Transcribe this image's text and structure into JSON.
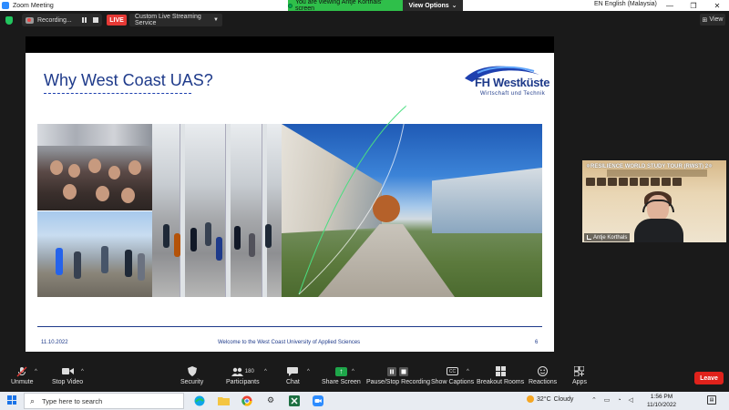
{
  "window": {
    "title": "Zoom Meeting",
    "controls": [
      "—",
      "❐",
      "✕"
    ]
  },
  "share_banner": {
    "message": "You are viewing Antje Korthals' screen",
    "view_options": "View Options"
  },
  "language": "EN English (Malaysia)",
  "recording": {
    "label": "Recording..."
  },
  "live_badge": "LIVE",
  "stream_service": "Custom Live Streaming Service",
  "view_button": "View",
  "slide": {
    "title": "Why West Coast UAS?",
    "logo_name": "FH Westküste",
    "logo_sub": "Wirtschaft und Technik",
    "footer_date": "11.10.2022",
    "footer_text": "Welcome to the West Coast University of Applied Sciences",
    "page_number": "6"
  },
  "participant_video": {
    "banner": "✵RESILIENCE WORLD STUDY TOUR (RWST) 2✵",
    "name": "Antje Korthals"
  },
  "toolbar": {
    "unmute": "Unmute",
    "stop_video": "Stop Video",
    "security": "Security",
    "participants": "Participants",
    "participants_count": "180",
    "chat": "Chat",
    "share_screen": "Share Screen",
    "pause_recording": "Pause/Stop Recording",
    "show_captions": "Show Captions",
    "breakout_rooms": "Breakout Rooms",
    "reactions": "Reactions",
    "apps": "Apps",
    "leave": "Leave"
  },
  "taskbar": {
    "search_placeholder": "Type here to search",
    "weather_temp": "32°C",
    "weather_desc": "Cloudy",
    "time": "1:56 PM",
    "date": "11/10/2022"
  },
  "colors": {
    "share_green": "#2fbf4a",
    "live_red": "#e53935",
    "leave_red": "#e0221b",
    "slide_blue": "#1e3a8a"
  }
}
